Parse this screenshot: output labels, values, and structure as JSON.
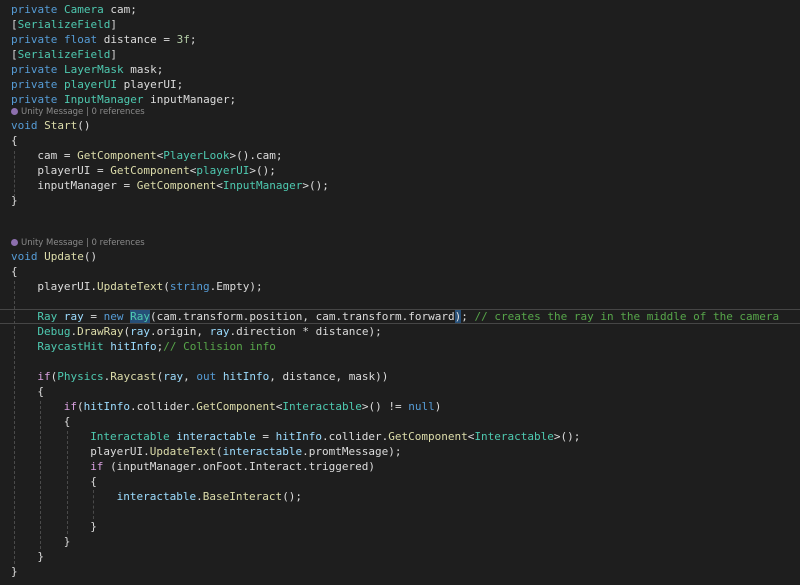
{
  "editor": {
    "lines": [
      {
        "i": 0,
        "t": [
          [
            "private ",
            "k"
          ],
          [
            "Camera",
            "t"
          ],
          [
            " cam;",
            "p"
          ]
        ]
      },
      {
        "i": 0,
        "t": [
          [
            "[",
            "p"
          ],
          [
            "SerializeField",
            "t"
          ],
          [
            "]",
            "p"
          ]
        ]
      },
      {
        "i": 0,
        "t": [
          [
            "private ",
            "k"
          ],
          [
            "float ",
            "k"
          ],
          [
            "distance = ",
            "p"
          ],
          [
            "3f",
            "n"
          ],
          [
            ";",
            "p"
          ]
        ]
      },
      {
        "i": 0,
        "t": [
          [
            "[",
            "p"
          ],
          [
            "SerializeField",
            "t"
          ],
          [
            "]",
            "p"
          ]
        ]
      },
      {
        "i": 0,
        "t": [
          [
            "private ",
            "k"
          ],
          [
            "LayerMask",
            "t"
          ],
          [
            " mask;",
            "p"
          ]
        ]
      },
      {
        "i": 0,
        "t": [
          [
            "private ",
            "k"
          ],
          [
            "playerUI",
            "t"
          ],
          [
            " playerUI;",
            "p"
          ]
        ]
      },
      {
        "i": 0,
        "t": [
          [
            "private ",
            "k"
          ],
          [
            "InputManager",
            "t"
          ],
          [
            " inputManager;",
            "p"
          ]
        ]
      },
      {
        "lens": "Unity Message | 0 references"
      },
      {
        "i": 0,
        "t": [
          [
            "void ",
            "k"
          ],
          [
            "Start",
            "m"
          ],
          [
            "()",
            "p"
          ]
        ]
      },
      {
        "i": 0,
        "t": [
          [
            "{",
            "p"
          ]
        ]
      },
      {
        "i": 1,
        "t": [
          [
            "cam = ",
            "p"
          ],
          [
            "GetComponent",
            "m"
          ],
          [
            "<",
            "p"
          ],
          [
            "PlayerLook",
            "t"
          ],
          [
            ">().cam;",
            "p"
          ]
        ]
      },
      {
        "i": 1,
        "t": [
          [
            "playerUI = ",
            "p"
          ],
          [
            "GetComponent",
            "m"
          ],
          [
            "<",
            "p"
          ],
          [
            "playerUI",
            "t"
          ],
          [
            ">();",
            "p"
          ]
        ]
      },
      {
        "i": 1,
        "t": [
          [
            "inputManager = ",
            "p"
          ],
          [
            "GetComponent",
            "m"
          ],
          [
            "<",
            "p"
          ],
          [
            "InputManager",
            "t"
          ],
          [
            ">();",
            "p"
          ]
        ]
      },
      {
        "i": 0,
        "t": [
          [
            "}",
            "p"
          ]
        ]
      },
      {
        "i": 0,
        "t": []
      },
      {
        "i": 0,
        "t": []
      },
      {
        "lens": "Unity Message | 0 references"
      },
      {
        "i": 0,
        "t": [
          [
            "void ",
            "k"
          ],
          [
            "Update",
            "m"
          ],
          [
            "()",
            "p"
          ]
        ]
      },
      {
        "i": 0,
        "t": [
          [
            "{",
            "p"
          ]
        ]
      },
      {
        "i": 1,
        "t": [
          [
            "playerUI.",
            "p"
          ],
          [
            "UpdateText",
            "m"
          ],
          [
            "(",
            "p"
          ],
          [
            "string",
            "k"
          ],
          [
            ".Empty);",
            "p"
          ]
        ]
      },
      {
        "i": 0,
        "t": []
      },
      {
        "i": 1,
        "cur": true,
        "t": [
          [
            "Ray",
            "t"
          ],
          [
            " ",
            "p"
          ],
          [
            "ray",
            "v"
          ],
          [
            " = ",
            "p"
          ],
          [
            "new ",
            "k"
          ],
          [
            "Ray",
            "t",
            "hl"
          ],
          [
            "(cam.transform.position, cam.transform.forward",
            "p"
          ],
          [
            ")",
            "p",
            "hl"
          ],
          [
            "; ",
            "p"
          ],
          [
            "// creates the ray in the middle of the camera",
            "c"
          ]
        ]
      },
      {
        "i": 1,
        "t": [
          [
            "Debug",
            "t"
          ],
          [
            ".",
            "p"
          ],
          [
            "DrawRay",
            "m"
          ],
          [
            "(",
            "p"
          ],
          [
            "ray",
            "v"
          ],
          [
            ".origin, ",
            "p"
          ],
          [
            "ray",
            "v"
          ],
          [
            ".direction * distance);",
            "p"
          ]
        ]
      },
      {
        "i": 1,
        "t": [
          [
            "RaycastHit",
            "t"
          ],
          [
            " ",
            "p"
          ],
          [
            "hitInfo",
            "v"
          ],
          [
            ";",
            "p"
          ],
          [
            "// Collision info",
            "c"
          ]
        ]
      },
      {
        "i": 0,
        "t": []
      },
      {
        "i": 1,
        "t": [
          [
            "if",
            "f"
          ],
          [
            "(",
            "p"
          ],
          [
            "Physics",
            "t"
          ],
          [
            ".",
            "p"
          ],
          [
            "Raycast",
            "m"
          ],
          [
            "(",
            "p"
          ],
          [
            "ray",
            "v"
          ],
          [
            ", ",
            "p"
          ],
          [
            "out ",
            "k"
          ],
          [
            "hitInfo",
            "v"
          ],
          [
            ", distance, mask))",
            "p"
          ]
        ]
      },
      {
        "i": 1,
        "t": [
          [
            "{",
            "p"
          ]
        ]
      },
      {
        "i": 2,
        "t": [
          [
            "if",
            "f"
          ],
          [
            "(",
            "p"
          ],
          [
            "hitInfo",
            "v"
          ],
          [
            ".collider.",
            "p"
          ],
          [
            "GetComponent",
            "m"
          ],
          [
            "<",
            "p"
          ],
          [
            "Interactable",
            "t"
          ],
          [
            ">() != ",
            "p"
          ],
          [
            "null",
            "k"
          ],
          [
            ")",
            "p"
          ]
        ]
      },
      {
        "i": 2,
        "t": [
          [
            "{",
            "p"
          ]
        ]
      },
      {
        "i": 3,
        "t": [
          [
            "Interactable",
            "t"
          ],
          [
            " ",
            "p"
          ],
          [
            "interactable",
            "v"
          ],
          [
            " = ",
            "p"
          ],
          [
            "hitInfo",
            "v"
          ],
          [
            ".collider.",
            "p"
          ],
          [
            "GetComponent",
            "m"
          ],
          [
            "<",
            "p"
          ],
          [
            "Interactable",
            "t"
          ],
          [
            ">();",
            "p"
          ]
        ]
      },
      {
        "i": 3,
        "t": [
          [
            "playerUI.",
            "p"
          ],
          [
            "UpdateText",
            "m"
          ],
          [
            "(",
            "p"
          ],
          [
            "interactable",
            "v"
          ],
          [
            ".promtMessage);",
            "p"
          ]
        ]
      },
      {
        "i": 3,
        "t": [
          [
            "if ",
            "f"
          ],
          [
            "(inputManager.onFoot.Interact.triggered)",
            "p"
          ]
        ]
      },
      {
        "i": 3,
        "t": [
          [
            "{",
            "p"
          ]
        ]
      },
      {
        "i": 4,
        "t": [
          [
            "interactable",
            "v"
          ],
          [
            ".",
            "p"
          ],
          [
            "BaseInteract",
            "m"
          ],
          [
            "();",
            "p"
          ]
        ]
      },
      {
        "i": 0,
        "t": []
      },
      {
        "i": 3,
        "t": [
          [
            "}",
            "p"
          ]
        ]
      },
      {
        "i": 2,
        "t": [
          [
            "}",
            "p"
          ]
        ]
      },
      {
        "i": 1,
        "t": [
          [
            "}",
            "p"
          ]
        ]
      },
      {
        "i": 0,
        "t": [
          [
            "}",
            "p"
          ]
        ]
      }
    ]
  }
}
